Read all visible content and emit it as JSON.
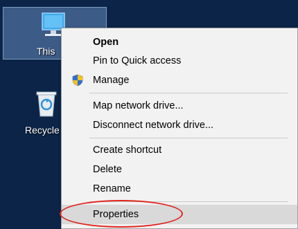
{
  "desktop": {
    "icons": [
      {
        "name": "this-pc",
        "label": "This",
        "icon": "monitor-icon"
      },
      {
        "name": "recycle-bin",
        "label": "Recycle",
        "icon": "recycle-bin-icon"
      }
    ]
  },
  "context_menu": {
    "items": [
      {
        "label": "Open",
        "bold": true
      },
      {
        "label": "Pin to Quick access"
      },
      {
        "label": "Manage",
        "icon": "uac-shield-icon"
      },
      {
        "label": "Map network drive..."
      },
      {
        "label": "Disconnect network drive..."
      },
      {
        "label": "Create shortcut"
      },
      {
        "label": "Delete"
      },
      {
        "label": "Rename"
      },
      {
        "label": "Properties",
        "highlighted": true
      }
    ]
  },
  "colors": {
    "desktop_bg": "#0b2448",
    "menu_bg": "#f2f2f2",
    "highlight": "#d9d9d9",
    "annotation": "#e0241e"
  }
}
